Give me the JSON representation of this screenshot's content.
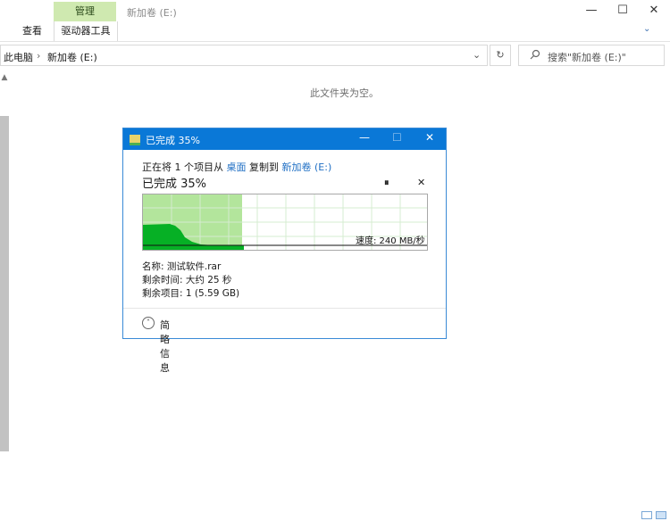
{
  "window": {
    "title": "新加卷 (E:)",
    "minimize_glyph": "—",
    "maximize_glyph": "☐",
    "close_glyph": "✕"
  },
  "ribbon": {
    "contextual_tab": "管理",
    "tabs": [
      "查看",
      "驱动器工具"
    ],
    "help_glyph": "⌄"
  },
  "address_bar": {
    "crumbs": [
      "此电脑",
      "新加卷 (E:)"
    ],
    "separator": "›",
    "dropdown_glyph": "⌄",
    "refresh_glyph": "↻"
  },
  "search": {
    "placeholder": "搜索\"新加卷 (E:)\"",
    "icon": "search-icon"
  },
  "main": {
    "empty_message": "此文件夹为空。"
  },
  "copy_dialog": {
    "title": "已完成 35%",
    "status_prefix": "正在将 1 个项目从",
    "source": "桌面",
    "mid_text": "复制到",
    "destination": "新加卷 (E:)",
    "heading": "已完成 35%",
    "pause_glyph": "⏸",
    "cancel_glyph": "✕",
    "progress_fraction": 0.35,
    "speed_label": "速度: 240 MB/秒",
    "name_label": "名称: 测试软件.rar",
    "time_left_label": "剩余时间: 大约 25 秒",
    "items_left_label": "剩余项目: 1 (5.59 GB)",
    "details_label": "简略信息",
    "details_glyph": "˄",
    "colors": {
      "titlebar": "#0a78d7",
      "progress_fill": "#b3e59c",
      "graph_line": "#06b025",
      "link": "#1f6fc4"
    }
  }
}
